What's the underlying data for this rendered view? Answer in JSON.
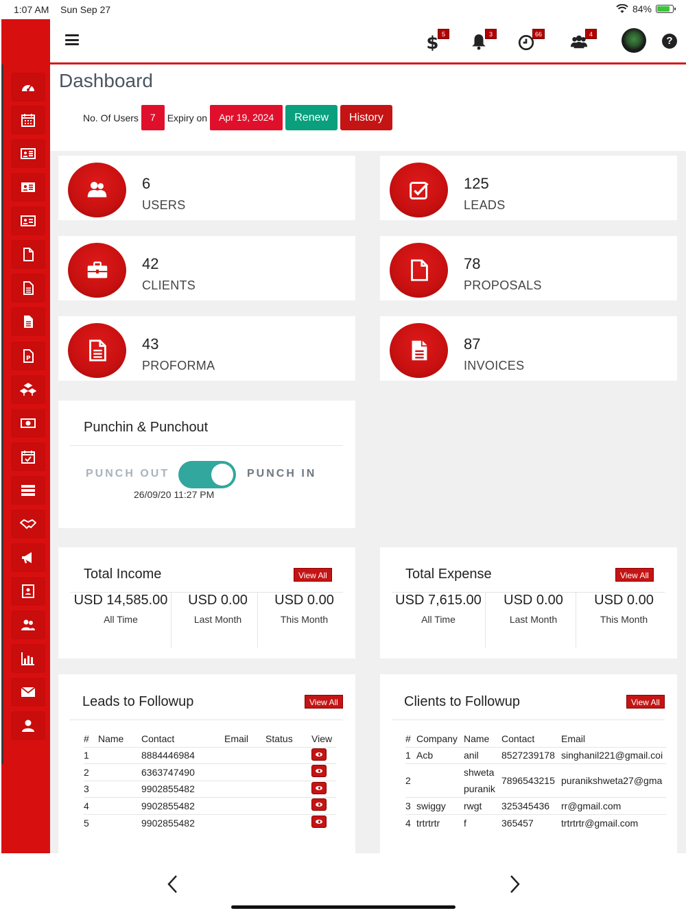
{
  "status_bar": {
    "time": "1:07 AM",
    "date": "Sun Sep 27",
    "battery": "84%",
    "battery_level": 0.84
  },
  "topbar": {
    "icons": [
      {
        "name": "dollar-icon",
        "badge": "5"
      },
      {
        "name": "bell-icon",
        "badge": "3"
      },
      {
        "name": "clock-icon",
        "badge": "66"
      },
      {
        "name": "users-icon",
        "badge": "4"
      }
    ],
    "help": "?"
  },
  "sidebar": {
    "items": [
      "dashboard-icon",
      "calendar-icon",
      "contact-card-icon",
      "id-card-icon",
      "profile-card-icon",
      "file-icon",
      "document-icon",
      "document-filled-icon",
      "proforma-icon",
      "boxes-icon",
      "money-icon",
      "calendar-check-icon",
      "server-icon",
      "handshake-icon",
      "megaphone-icon",
      "address-book-icon",
      "users-icon",
      "bar-chart-icon",
      "mail-icon",
      "user-icon"
    ]
  },
  "header": {
    "title": "Dashboard",
    "users_label": "No. Of Users",
    "users_value": "7",
    "expiry_label": "Expiry on",
    "expiry_value": "Apr 19, 2024",
    "renew_label": "Renew",
    "history_label": "History"
  },
  "stats": [
    {
      "value": "6",
      "label": "USERS",
      "icon": "users-icon"
    },
    {
      "value": "125",
      "label": "LEADS",
      "icon": "checkbox-icon"
    },
    {
      "value": "42",
      "label": "CLIENTS",
      "icon": "briefcase-icon"
    },
    {
      "value": "78",
      "label": "PROPOSALS",
      "icon": "file-icon"
    },
    {
      "value": "43",
      "label": "PROFORMA",
      "icon": "document-icon"
    },
    {
      "value": "87",
      "label": "INVOICES",
      "icon": "invoice-icon"
    }
  ],
  "punch": {
    "title": "Punchin & Punchout",
    "out_label": "PUNCH OUT",
    "in_label": "PUNCH IN",
    "toggle_on": true,
    "timestamp": "26/09/20 11:27 PM"
  },
  "income": {
    "title": "Total Income",
    "view_all": "View All",
    "cols": [
      {
        "amount": "USD 14,585.00",
        "period": "All Time"
      },
      {
        "amount": "USD 0.00",
        "period": "Last Month"
      },
      {
        "amount": "USD 0.00",
        "period": "This Month"
      }
    ]
  },
  "expense": {
    "title": "Total Expense",
    "view_all": "View All",
    "cols": [
      {
        "amount": "USD 7,615.00",
        "period": "All Time"
      },
      {
        "amount": "USD 0.00",
        "period": "Last Month"
      },
      {
        "amount": "USD 0.00",
        "period": "This Month"
      }
    ]
  },
  "leads": {
    "title": "Leads to Followup",
    "view_all": "View All",
    "headers": [
      "#",
      "Name",
      "Contact",
      "Email",
      "Status",
      "View"
    ],
    "rows": [
      [
        "1",
        "",
        "8884446984",
        "",
        ""
      ],
      [
        "2",
        "",
        "6363747490",
        "",
        ""
      ],
      [
        "3",
        "",
        "9902855482",
        "",
        ""
      ],
      [
        "4",
        "",
        "9902855482",
        "",
        ""
      ],
      [
        "5",
        "",
        "9902855482",
        "",
        ""
      ]
    ]
  },
  "clients": {
    "title": "Clients to Followup",
    "view_all": "View All",
    "headers": [
      "#",
      "Company",
      "Name",
      "Contact",
      "Email"
    ],
    "rows": [
      [
        "1",
        "Acb",
        "anil",
        "8527239178",
        "singhanil221@gmail.coi"
      ],
      [
        "2",
        "",
        "shweta puranik",
        "7896543215",
        "puranikshweta27@gma"
      ],
      [
        "3",
        "swiggy",
        "rwgt",
        "325345436",
        "rr@gmail.com"
      ],
      [
        "4",
        "trtrtrtr",
        "f",
        "365457",
        "trtrtrtr@gmail.com"
      ]
    ]
  },
  "colors": {
    "brand_red": "#d80f0f",
    "button_green": "#0aa07e",
    "toggle_teal": "#31a79d"
  }
}
